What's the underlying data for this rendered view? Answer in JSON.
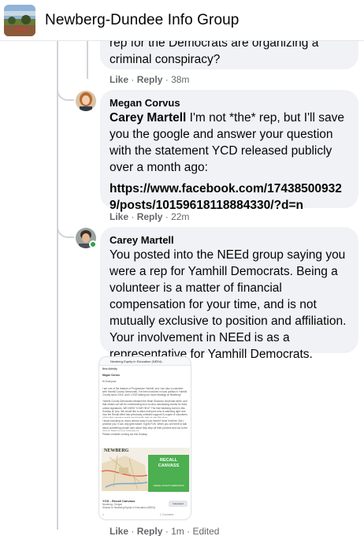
{
  "header": {
    "group_name": "Newberg-Dundee Info Group"
  },
  "comment0": {
    "text_line1": "rep for the Democrats are organizing a",
    "text_line2": "criminal conspiracy?",
    "like": "Like",
    "reply": "Reply",
    "time": "38m"
  },
  "comment1": {
    "author": "Megan Corvus",
    "mention": "Carey Martell",
    "text": " I'm not *the* rep, but I'll save you the google and answer your question with the statement YCD released publicly over a month ago:",
    "link": "https://www.facebook.com/174385009329/posts/10159618118884330/?d=n",
    "like": "Like",
    "reply": "Reply",
    "time": "22m"
  },
  "comment2": {
    "author": "Carey Martell",
    "text": "You posted into the NEEd group saying you were a rep for Yamhill Democrats. Being a volunteer is a matter of financial compensation for your time, and is not mutually exclusive to position and affiliation. Your involvement in NEEd is as a representative for Yamhill Democrats.",
    "like": "Like",
    "reply": "Reply",
    "time": "1m",
    "edited": "Edited"
  },
  "attachment": {
    "group_title": "Newberg Equity in Education (NEEd)",
    "new_activity": "New Activity",
    "poster": "Megan Corvus",
    "greeting": "Hi Everyone",
    "body_1": "I am one of the leaders of Progressive Yamhill, and I am also a volunteer with Yamhill County Democrats. I've been involved in local politics in Yamhill County since 2016, and I LOVE talking too much strategy w/ Newberg!",
    "body_2": "Yamhill County Democrats released the Brian Shannon recall last week, and that means we will be commanding door-to-door canvassing events for folks collect signatures. WE NEED YOUR HELP. The first Newberg event is this Sunday at 1pm. We would like to allow everyone who is watching right now how the Recall effort has previously unfolded support! A couple of volunteers at the first canvass event would really help to win this story.",
    "body_3": "I know knocking on doors seems scary if you haven't done it before. But I promise you: It can only gets easier. It gets FUN. When you are there to talk about something people care about they step off their porches and out to the door to thank you for stopping by.",
    "body_4": "Please consider coming out this Sunday.",
    "map_label": "NEWBERG",
    "recall_title": "RECALL CANVASS",
    "party_label": "YAMHILL COUNTY DEMOCRATS",
    "ycd_title": "YCD - Recall Canvass",
    "ycd_sub_1": "Newberg, Oregon",
    "ycd_sub_2": "Shared to Newberg Equity in Education (NEEd)",
    "interested": "Interested",
    "reaction_count": "1",
    "comment_count": "1 Comment"
  },
  "colors": {
    "bubble_bg": "#f0f2f5",
    "meta_text": "#65676b",
    "online": "#31a24c",
    "recall_green": "#4caf50"
  }
}
